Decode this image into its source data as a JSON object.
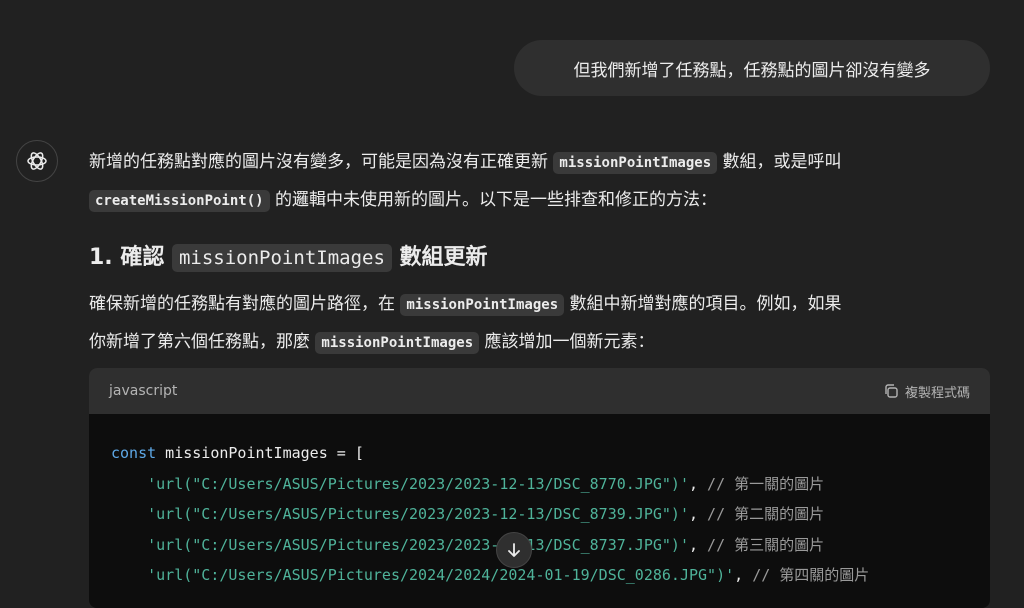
{
  "user_message": "但我們新增了任務點，任務點的圖片卻沒有變多",
  "assistant": {
    "para1": {
      "t1": "新增的任務點對應的圖片沒有變多，可能是因為沒有正確更新 ",
      "c1": "missionPointImages",
      "t2": " 數組，或是呼叫",
      "c2": "createMissionPoint()",
      "t3": " 的邏輯中未使用新的圖片。以下是一些排查和修正的方法："
    },
    "heading": {
      "prefix": "1. 確認 ",
      "code": "missionPointImages",
      "suffix": " 數組更新"
    },
    "para2": {
      "t1": "確保新增的任務點有對應的圖片路徑，在 ",
      "c1": "missionPointImages",
      "t2": " 數組中新增對應的項目。例如，如果",
      "t3": "你新增了第六個任務點，那麼 ",
      "c2": "missionPointImages",
      "t4": " 應該增加一個新元素："
    },
    "code_block": {
      "language": "javascript",
      "copy_label": "複製程式碼",
      "decl_keyword": "const",
      "decl_rest": " missionPointImages = [",
      "lines": [
        {
          "str": "'url(\"C:/Users/ASUS/Pictures/2023/2023-12-13/DSC_8770.JPG\")'",
          "comment": "// 第一關的圖片"
        },
        {
          "str": "'url(\"C:/Users/ASUS/Pictures/2023/2023-12-13/DSC_8739.JPG\")'",
          "comment": "// 第二關的圖片"
        },
        {
          "str": "'url(\"C:/Users/ASUS/Pictures/2023/2023-12-13/DSC_8737.JPG\")'",
          "comment": "// 第三關的圖片"
        },
        {
          "str": "'url(\"C:/Users/ASUS/Pictures/2024/2024/2024-01-19/DSC_0286.JPG\")'",
          "comment": "// 第四關的圖片"
        }
      ]
    }
  },
  "icons": {
    "avatar": "openai-logo-icon",
    "copy": "copy-icon",
    "scroll": "arrow-down-icon"
  }
}
